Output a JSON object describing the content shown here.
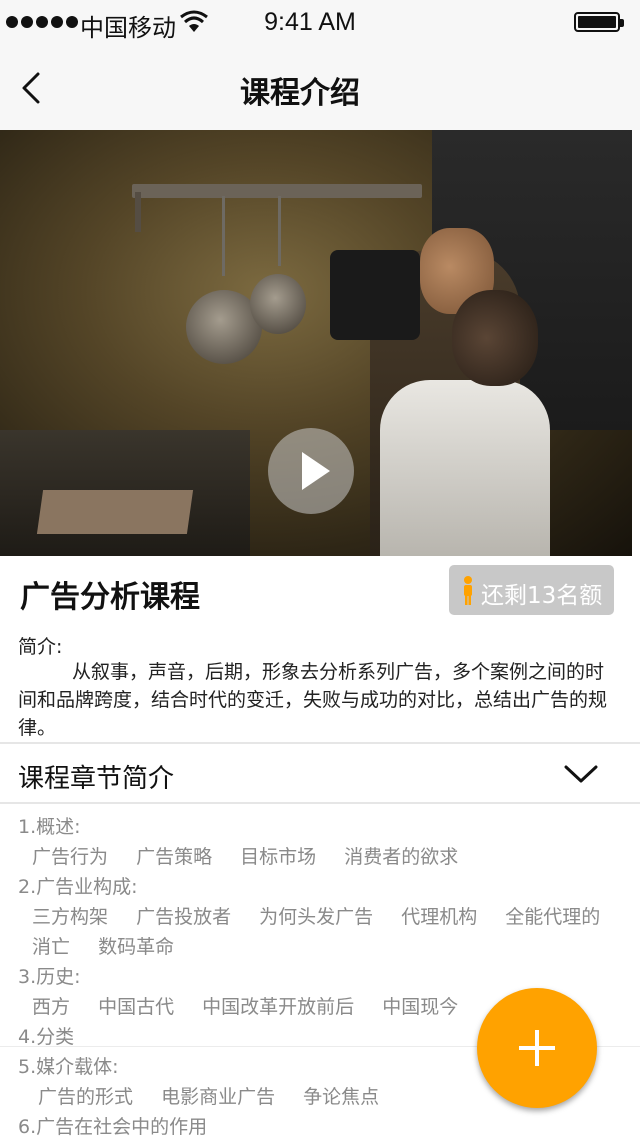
{
  "status_bar": {
    "carrier": "中国移动",
    "time": "9:41 AM"
  },
  "nav": {
    "title": "课程介绍",
    "back_icon": "chevron-left-icon"
  },
  "video": {
    "play_icon": "play-icon"
  },
  "course": {
    "title": "广告分析课程",
    "quota_label": "还剩13名额",
    "quota_icon": "person-icon",
    "intro_label": "简介:",
    "intro_text": "从叙事，声音，后期，形象去分析系列广告，多个案例之间的时间和品牌跨度，结合时代的变迁，失败与成功的对比，总结出广告的规律。"
  },
  "chapters": {
    "header": "课程章节简介",
    "toggle_icon": "chevron-down-icon",
    "list": [
      {
        "title": "1.概述:",
        "items": [
          "广告行为",
          "广告策略",
          "目标市场",
          "消费者的欲求"
        ]
      },
      {
        "title": "2.广告业构成:",
        "items": [
          "三方构架",
          "广告投放者",
          "为何头发广告",
          "代理机构",
          "全能代理的"
        ],
        "items2": [
          "消亡",
          "数码革命"
        ]
      },
      {
        "title": "3.历史:",
        "items": [
          "西方",
          "中国古代",
          "中国改革开放前后",
          "中国现今"
        ]
      },
      {
        "title": "4.分类",
        "items": []
      },
      {
        "title": "5.媒介载体:",
        "items": [
          "广告的形式",
          "电影商业广告",
          "争论焦点"
        ]
      },
      {
        "title": "6.广告在社会中的作用",
        "items": []
      }
    ]
  },
  "fab": {
    "icon": "plus-icon",
    "color": "#ffa200"
  }
}
